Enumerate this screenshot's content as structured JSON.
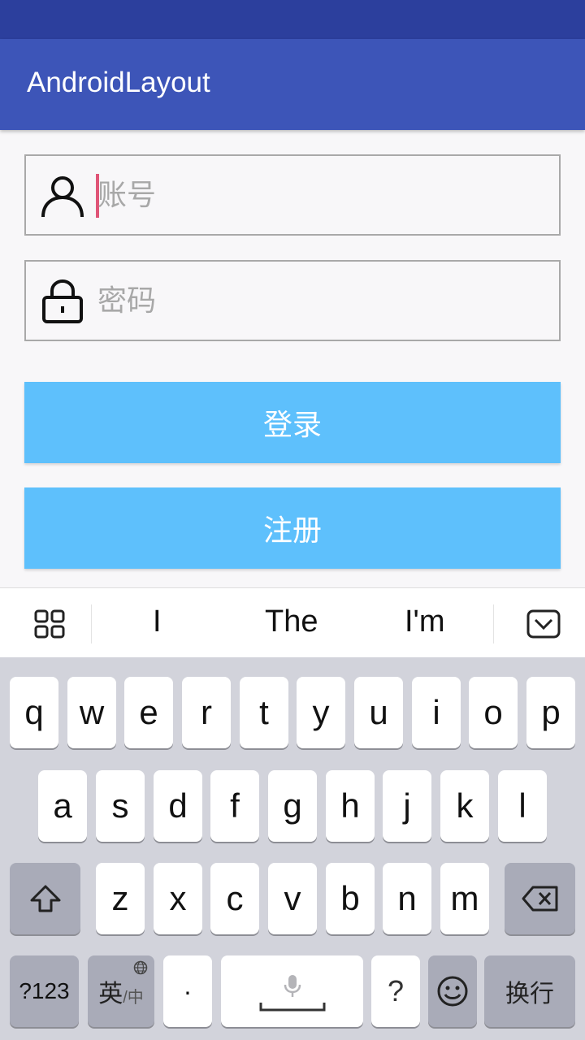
{
  "app": {
    "title": "AndroidLayout"
  },
  "form": {
    "account_placeholder": "账号",
    "password_placeholder": "密码",
    "login_label": "登录",
    "register_label": "注册"
  },
  "keyboard": {
    "suggestions": [
      "I",
      "The",
      "I'm"
    ],
    "row1": [
      "q",
      "w",
      "e",
      "r",
      "t",
      "y",
      "u",
      "i",
      "o",
      "p"
    ],
    "row2": [
      "a",
      "s",
      "d",
      "f",
      "g",
      "h",
      "j",
      "k",
      "l"
    ],
    "row3": [
      "z",
      "x",
      "c",
      "v",
      "b",
      "n",
      "m"
    ],
    "num_label": "?123",
    "lang_label": "英",
    "lang_sub": "/中",
    "dot_label": "·",
    "question_label": "?",
    "enter_label": "换行"
  },
  "colors": {
    "status": "#2c3f9d",
    "appbar": "#3d55b8",
    "button": "#5ec0fc",
    "cursor": "#e05577"
  },
  "icons": [
    "user-icon",
    "lock-icon",
    "grid-icon",
    "keyboard-hide-icon",
    "shift-icon",
    "backspace-icon",
    "globe-icon",
    "mic-icon",
    "emoji-icon"
  ]
}
